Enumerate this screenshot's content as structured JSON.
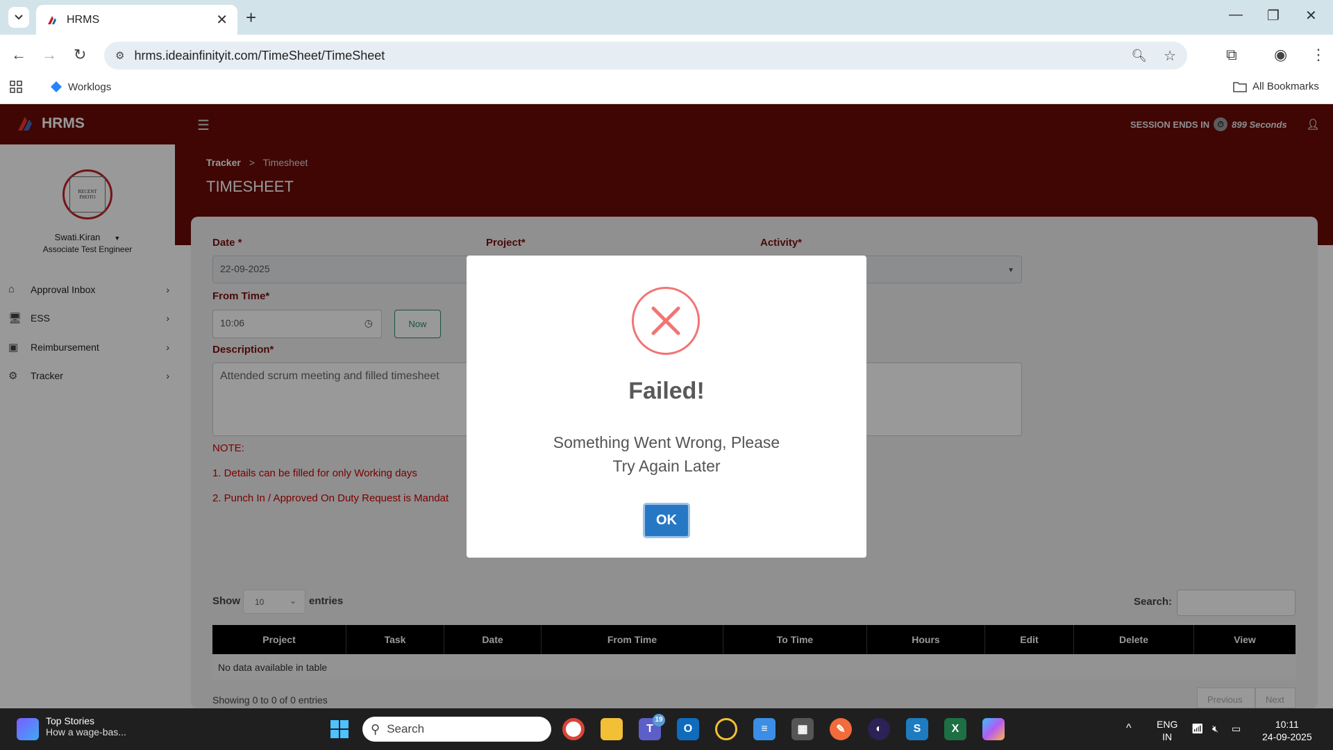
{
  "browser": {
    "tab_title": "HRMS",
    "url": "hrms.ideainfinityit.com/TimeSheet/TimeSheet",
    "bookmark": "Worklogs",
    "all_bookmarks": "All Bookmarks"
  },
  "app": {
    "logo_text": "HRMS",
    "session_label": "SESSION ENDS IN",
    "session_seconds": "899 Seconds"
  },
  "breadcrumb": {
    "parent": "Tracker",
    "sep": ">",
    "current": "Timesheet"
  },
  "page_title": "TIMESHEET",
  "user": {
    "photo_text": "RECENT PHOTO",
    "name": "Swati.Kiran",
    "role": "Associate Test Engineer"
  },
  "sidebar": {
    "items": [
      {
        "label": "Approval Inbox",
        "icon": "home-icon"
      },
      {
        "label": "ESS",
        "icon": "monitor-icon"
      },
      {
        "label": "Reimbursement",
        "icon": "money-icon"
      },
      {
        "label": "Tracker",
        "icon": "gear-icon"
      }
    ]
  },
  "form": {
    "date_label": "Date *",
    "date_value": "22-09-2025",
    "project_label": "Project*",
    "activity_label": "Activity*",
    "from_time_label": "From Time*",
    "from_time_value": "10:06",
    "now_button": "Now",
    "description_label": "Description*",
    "description_value": "Attended scrum meeting and filled timesheet",
    "note_title": "NOTE:",
    "note_1": "1. Details can be filled for only Working days",
    "note_2": "2. Punch In / Approved On Duty Request is Mandat"
  },
  "table": {
    "show_label": "Show",
    "entries_value": "10",
    "entries_label": "entries",
    "search_label": "Search:",
    "columns": [
      "Project",
      "Task",
      "Date",
      "From Time",
      "To Time",
      "Hours",
      "Edit",
      "Delete",
      "View"
    ],
    "empty_text": "No data available in table",
    "info_text": "Showing 0 to 0 of 0 entries",
    "prev": "Previous",
    "next": "Next"
  },
  "modal": {
    "title": "Failed!",
    "message_line1": "Something Went Wrong, Please",
    "message_line2": "Try Again Later",
    "ok_button": "OK"
  },
  "taskbar": {
    "news_title": "Top Stories",
    "news_sub": "How a wage-bas...",
    "search_placeholder": "Search",
    "teams_badge": "19",
    "lang": "ENG",
    "region": "IN",
    "time": "10:11",
    "date": "24-09-2025"
  },
  "colors": {
    "header": "#6a0a05",
    "label": "#7a1010",
    "ok": "#2778c4",
    "error": "#f27474"
  }
}
